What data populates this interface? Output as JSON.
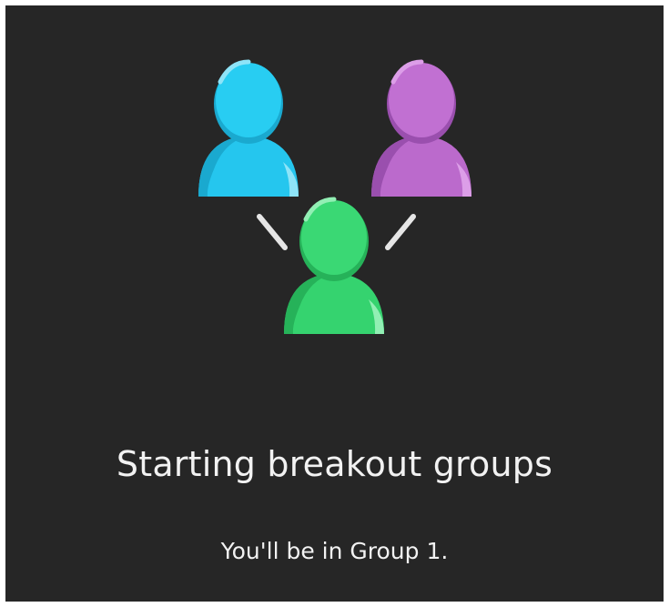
{
  "dialog": {
    "title": "Starting breakout groups",
    "message": "You'll be in Group 1."
  },
  "icons": [
    "person-icon-blue",
    "person-icon-purple",
    "person-icon-green",
    "connector-line-icon"
  ],
  "colors": {
    "background": "#262626",
    "text": "#f2f2f2",
    "person_blue": "#25c6ee",
    "person_purple": "#bb6acc",
    "person_green": "#35d36f",
    "connector": "#e6e6e6"
  }
}
